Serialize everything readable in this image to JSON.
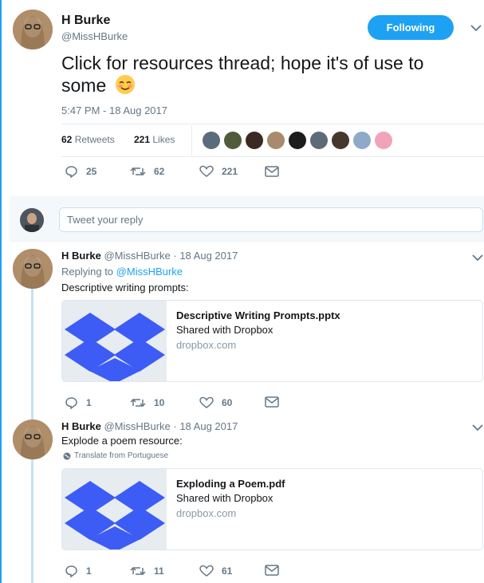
{
  "main_tweet": {
    "author_name": "H Burke",
    "author_handle": "@MissHBurke",
    "follow_label": "Following",
    "text": "Click for resources thread; hope it's of use to some",
    "emoji": "☺",
    "timestamp": "5:47 PM - 18 Aug 2017",
    "retweets_count": "62",
    "retweets_label": "Retweets",
    "likes_count": "221",
    "likes_label": "Likes",
    "replies": "25",
    "retweets": "62",
    "likes": "221"
  },
  "likers_colors": [
    "#5a6b7c",
    "#4f5b3c",
    "#3a2a24",
    "#a98a6c",
    "#1c1c1c",
    "#5d6a78",
    "#46372d",
    "#8fa9c8",
    "#f1a3b8"
  ],
  "reply_box": {
    "placeholder": "Tweet your reply"
  },
  "replies": [
    {
      "author_name": "H Burke",
      "author_handle": "@MissHBurke",
      "date": "· 18 Aug 2017",
      "replying_to_label": "Replying to",
      "replying_to_handle": "@MissHBurke",
      "text": "Descriptive writing prompts:",
      "card": {
        "title": "Descriptive Writing Prompts.pptx",
        "description": "Shared with Dropbox",
        "domain": "dropbox.com"
      },
      "replies": "1",
      "retweets": "10",
      "likes": "60"
    },
    {
      "author_name": "H Burke",
      "author_handle": "@MissHBurke",
      "date": "· 18 Aug 2017",
      "text": "Explode a poem resource:",
      "translate": "Translate from Portuguese",
      "card": {
        "title": "Exploding a Poem.pdf",
        "description": "Shared with Dropbox",
        "domain": "dropbox.com"
      },
      "replies": "1",
      "retweets": "11",
      "likes": "61"
    }
  ],
  "colors": {
    "accent": "#1da1f2",
    "dropbox_blue": "#3d5cf5",
    "muted": "#657786"
  }
}
